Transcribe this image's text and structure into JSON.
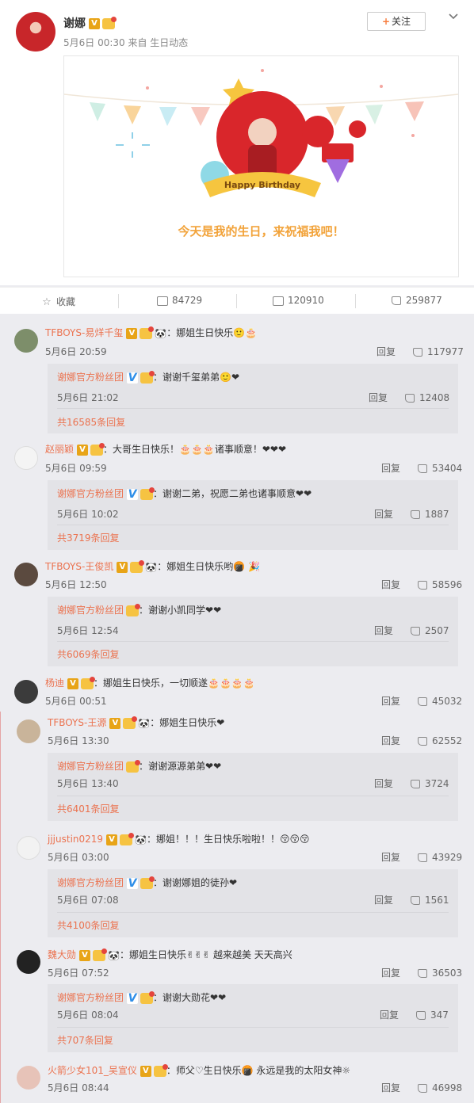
{
  "post": {
    "author": "谢娜",
    "meta": "5月6日 00:30 来自 生日动态",
    "follow_label": "关注",
    "follow_plus": "+",
    "card_banner": "Happy Birthday",
    "card_text": "今天是我的生日，来祝福我吧！"
  },
  "actions": {
    "favorite": "收藏",
    "forward_count": "84729",
    "comment_count": "120910",
    "like_count": "259877"
  },
  "comments": [
    {
      "name": "TFBOYS-易烊千玺",
      "text": "：娜姐生日快乐🙂🎂",
      "time": "5月6日 20:59",
      "reply_label": "回复",
      "likes": "117977",
      "reply": {
        "name": "谢娜官方粉丝团",
        "text": "：谢谢千玺弟弟🙂❤",
        "time": "5月6日 21:02",
        "reply_label": "回复",
        "likes": "12408",
        "more": "共16585条回复"
      }
    },
    {
      "name": "赵丽颖",
      "text": "：大哥生日快乐！🎂🎂🎂诸事顺意！❤❤❤",
      "time": "5月6日 09:59",
      "reply_label": "回复",
      "likes": "53404",
      "reply": {
        "name": "谢娜官方粉丝团",
        "text": "：谢谢二弟，祝愿二弟也诸事顺意❤❤",
        "time": "5月6日 10:02",
        "reply_label": "回复",
        "likes": "1887",
        "more": "共3719条回复"
      }
    },
    {
      "name": "TFBOYS-王俊凯",
      "text": "：娜姐生日快乐哟🍘 🎉",
      "time": "5月6日 12:50",
      "reply_label": "回复",
      "likes": "58596",
      "reply": {
        "name": "谢娜官方粉丝团",
        "text": "：谢谢小凯同学❤❤",
        "time": "5月6日 12:54",
        "reply_label": "回复",
        "likes": "2507",
        "more": "共6069条回复"
      }
    },
    {
      "name": "杨迪",
      "text": "：娜姐生日快乐，一切顺遂🎂🎂🎂🎂",
      "time": "5月6日 00:51",
      "reply_label": "回复",
      "likes": "45032"
    },
    {
      "name": "TFBOYS-王源",
      "text": "：娜姐生日快乐❤",
      "time": "5月6日 13:30",
      "reply_label": "回复",
      "likes": "62552",
      "reply": {
        "name": "谢娜官方粉丝团",
        "text": "：谢谢源源弟弟❤❤",
        "time": "5月6日 13:40",
        "reply_label": "回复",
        "likes": "3724",
        "more": "共6401条回复"
      }
    },
    {
      "name": "jjjustin0219",
      "text": "：娜姐！！！生日快乐啦啦！！😚😚😚",
      "time": "5月6日 03:00",
      "reply_label": "回复",
      "likes": "43929",
      "reply": {
        "name": "谢娜官方粉丝团",
        "text": "：谢谢娜姐的徒孙❤",
        "time": "5月6日 07:08",
        "reply_label": "回复",
        "likes": "1561",
        "more": "共4100条回复"
      }
    },
    {
      "name": "魏大勋",
      "text": "：娜姐生日快乐✌✌✌ 越来越美 天天高兴",
      "time": "5月6日 07:52",
      "reply_label": "回复",
      "likes": "36503",
      "reply": {
        "name": "谢娜官方粉丝团",
        "text": "：谢谢大勋花❤❤",
        "time": "5月6日 08:04",
        "reply_label": "回复",
        "likes": "347",
        "more": "共707条回复"
      }
    },
    {
      "name": "火箭少女101_吴宣仪",
      "text": "：师父♡生日快乐🍘 永远是我的太阳女神☼",
      "time": "5月6日 08:44",
      "reply_label": "回复",
      "likes": "46998"
    }
  ]
}
